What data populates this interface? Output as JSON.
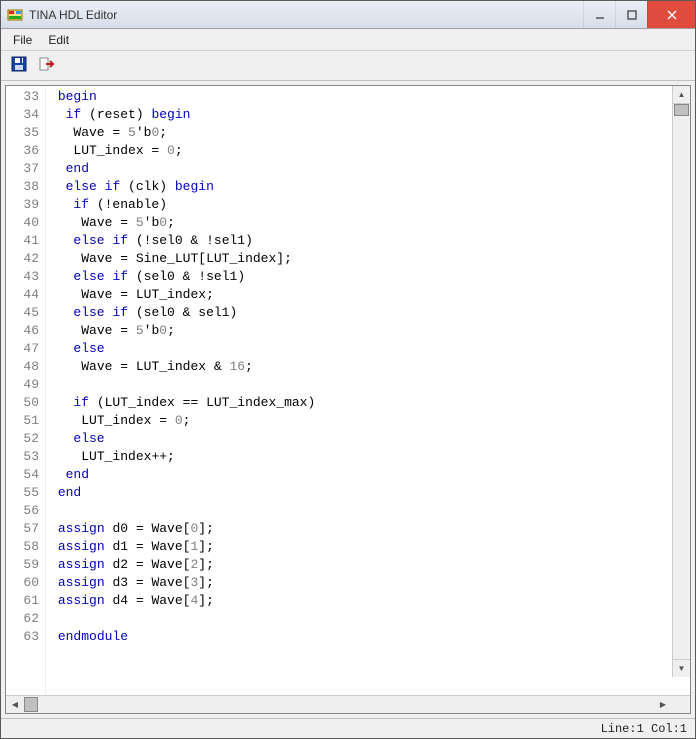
{
  "window": {
    "title": "TINA HDL Editor"
  },
  "menu": {
    "file": "File",
    "edit": "Edit"
  },
  "toolbar_icons": {
    "save": "save-icon",
    "export": "export-icon"
  },
  "status": {
    "position": "Line:1 Col:1"
  },
  "editor": {
    "first_line": 33,
    "lines": [
      {
        "n": 33,
        "indent": 1,
        "tokens": [
          [
            "kw",
            "begin"
          ]
        ]
      },
      {
        "n": 34,
        "indent": 2,
        "tokens": [
          [
            "kw",
            "if"
          ],
          [
            "op",
            " ("
          ],
          [
            "id",
            "reset"
          ],
          [
            "op",
            ") "
          ],
          [
            "kw",
            "begin"
          ]
        ]
      },
      {
        "n": 35,
        "indent": 3,
        "tokens": [
          [
            "id",
            "Wave"
          ],
          [
            "op",
            " = "
          ],
          [
            "num",
            "5"
          ],
          [
            "op",
            "'b"
          ],
          [
            "num",
            "0"
          ],
          [
            "op",
            ";"
          ]
        ]
      },
      {
        "n": 36,
        "indent": 3,
        "tokens": [
          [
            "id",
            "LUT_index"
          ],
          [
            "op",
            " = "
          ],
          [
            "num",
            "0"
          ],
          [
            "op",
            ";"
          ]
        ]
      },
      {
        "n": 37,
        "indent": 2,
        "tokens": [
          [
            "kw",
            "end"
          ]
        ]
      },
      {
        "n": 38,
        "indent": 2,
        "tokens": [
          [
            "kw",
            "else"
          ],
          [
            "op",
            " "
          ],
          [
            "kw",
            "if"
          ],
          [
            "op",
            " ("
          ],
          [
            "id",
            "clk"
          ],
          [
            "op",
            ") "
          ],
          [
            "kw",
            "begin"
          ]
        ]
      },
      {
        "n": 39,
        "indent": 3,
        "tokens": [
          [
            "kw",
            "if"
          ],
          [
            "op",
            " (!"
          ],
          [
            "id",
            "enable"
          ],
          [
            "op",
            ")"
          ]
        ]
      },
      {
        "n": 40,
        "indent": 4,
        "tokens": [
          [
            "id",
            "Wave"
          ],
          [
            "op",
            " = "
          ],
          [
            "num",
            "5"
          ],
          [
            "op",
            "'b"
          ],
          [
            "num",
            "0"
          ],
          [
            "op",
            ";"
          ]
        ]
      },
      {
        "n": 41,
        "indent": 3,
        "tokens": [
          [
            "kw",
            "else"
          ],
          [
            "op",
            " "
          ],
          [
            "kw",
            "if"
          ],
          [
            "op",
            " (!"
          ],
          [
            "id",
            "sel0"
          ],
          [
            "op",
            " & !"
          ],
          [
            "id",
            "sel1"
          ],
          [
            "op",
            ")"
          ]
        ]
      },
      {
        "n": 42,
        "indent": 4,
        "tokens": [
          [
            "id",
            "Wave"
          ],
          [
            "op",
            " = "
          ],
          [
            "id",
            "Sine_LUT"
          ],
          [
            "op",
            "["
          ],
          [
            "id",
            "LUT_index"
          ],
          [
            "op",
            "];"
          ]
        ]
      },
      {
        "n": 43,
        "indent": 3,
        "tokens": [
          [
            "kw",
            "else"
          ],
          [
            "op",
            " "
          ],
          [
            "kw",
            "if"
          ],
          [
            "op",
            " ("
          ],
          [
            "id",
            "sel0"
          ],
          [
            "op",
            " & !"
          ],
          [
            "id",
            "sel1"
          ],
          [
            "op",
            ")"
          ]
        ]
      },
      {
        "n": 44,
        "indent": 4,
        "tokens": [
          [
            "id",
            "Wave"
          ],
          [
            "op",
            " = "
          ],
          [
            "id",
            "LUT_index"
          ],
          [
            "op",
            ";"
          ]
        ]
      },
      {
        "n": 45,
        "indent": 3,
        "tokens": [
          [
            "kw",
            "else"
          ],
          [
            "op",
            " "
          ],
          [
            "kw",
            "if"
          ],
          [
            "op",
            " ("
          ],
          [
            "id",
            "sel0"
          ],
          [
            "op",
            " & "
          ],
          [
            "id",
            "sel1"
          ],
          [
            "op",
            ")"
          ]
        ]
      },
      {
        "n": 46,
        "indent": 4,
        "tokens": [
          [
            "id",
            "Wave"
          ],
          [
            "op",
            " = "
          ],
          [
            "num",
            "5"
          ],
          [
            "op",
            "'b"
          ],
          [
            "num",
            "0"
          ],
          [
            "op",
            ";"
          ]
        ]
      },
      {
        "n": 47,
        "indent": 3,
        "tokens": [
          [
            "kw",
            "else"
          ]
        ]
      },
      {
        "n": 48,
        "indent": 4,
        "tokens": [
          [
            "id",
            "Wave"
          ],
          [
            "op",
            " = "
          ],
          [
            "id",
            "LUT_index"
          ],
          [
            "op",
            " & "
          ],
          [
            "num",
            "16"
          ],
          [
            "op",
            ";"
          ]
        ]
      },
      {
        "n": 49,
        "indent": 0,
        "tokens": []
      },
      {
        "n": 50,
        "indent": 3,
        "tokens": [
          [
            "kw",
            "if"
          ],
          [
            "op",
            " ("
          ],
          [
            "id",
            "LUT_index"
          ],
          [
            "op",
            " == "
          ],
          [
            "id",
            "LUT_index_max"
          ],
          [
            "op",
            ")"
          ]
        ]
      },
      {
        "n": 51,
        "indent": 4,
        "tokens": [
          [
            "id",
            "LUT_index"
          ],
          [
            "op",
            " = "
          ],
          [
            "num",
            "0"
          ],
          [
            "op",
            ";"
          ]
        ]
      },
      {
        "n": 52,
        "indent": 3,
        "tokens": [
          [
            "kw",
            "else"
          ]
        ]
      },
      {
        "n": 53,
        "indent": 4,
        "tokens": [
          [
            "id",
            "LUT_index"
          ],
          [
            "op",
            "++;"
          ]
        ]
      },
      {
        "n": 54,
        "indent": 2,
        "tokens": [
          [
            "kw",
            "end"
          ]
        ]
      },
      {
        "n": 55,
        "indent": 1,
        "tokens": [
          [
            "kw",
            "end"
          ]
        ]
      },
      {
        "n": 56,
        "indent": 0,
        "tokens": []
      },
      {
        "n": 57,
        "indent": 1,
        "tokens": [
          [
            "kw",
            "assign"
          ],
          [
            "op",
            " "
          ],
          [
            "id",
            "d0"
          ],
          [
            "op",
            " = "
          ],
          [
            "id",
            "Wave"
          ],
          [
            "op",
            "["
          ],
          [
            "num",
            "0"
          ],
          [
            "op",
            "];"
          ]
        ]
      },
      {
        "n": 58,
        "indent": 1,
        "tokens": [
          [
            "kw",
            "assign"
          ],
          [
            "op",
            " "
          ],
          [
            "id",
            "d1"
          ],
          [
            "op",
            " = "
          ],
          [
            "id",
            "Wave"
          ],
          [
            "op",
            "["
          ],
          [
            "num",
            "1"
          ],
          [
            "op",
            "];"
          ]
        ]
      },
      {
        "n": 59,
        "indent": 1,
        "tokens": [
          [
            "kw",
            "assign"
          ],
          [
            "op",
            " "
          ],
          [
            "id",
            "d2"
          ],
          [
            "op",
            " = "
          ],
          [
            "id",
            "Wave"
          ],
          [
            "op",
            "["
          ],
          [
            "num",
            "2"
          ],
          [
            "op",
            "];"
          ]
        ]
      },
      {
        "n": 60,
        "indent": 1,
        "tokens": [
          [
            "kw",
            "assign"
          ],
          [
            "op",
            " "
          ],
          [
            "id",
            "d3"
          ],
          [
            "op",
            " = "
          ],
          [
            "id",
            "Wave"
          ],
          [
            "op",
            "["
          ],
          [
            "num",
            "3"
          ],
          [
            "op",
            "];"
          ]
        ]
      },
      {
        "n": 61,
        "indent": 1,
        "tokens": [
          [
            "kw",
            "assign"
          ],
          [
            "op",
            " "
          ],
          [
            "id",
            "d4"
          ],
          [
            "op",
            " = "
          ],
          [
            "id",
            "Wave"
          ],
          [
            "op",
            "["
          ],
          [
            "num",
            "4"
          ],
          [
            "op",
            "];"
          ]
        ]
      },
      {
        "n": 62,
        "indent": 0,
        "tokens": []
      },
      {
        "n": 63,
        "indent": 1,
        "tokens": [
          [
            "kw",
            "endmodule"
          ]
        ]
      }
    ]
  }
}
